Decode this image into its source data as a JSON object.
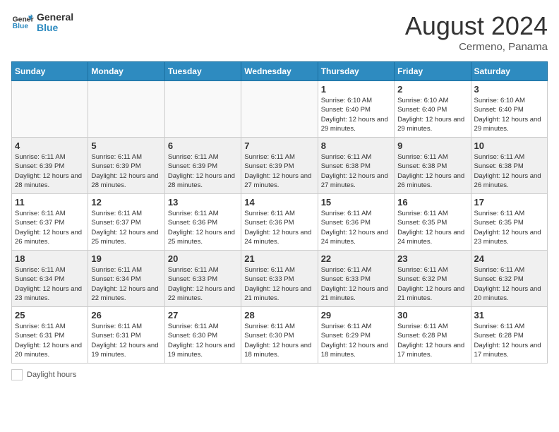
{
  "logo": {
    "text_general": "General",
    "text_blue": "Blue"
  },
  "header": {
    "month": "August 2024",
    "location": "Cermeno, Panama"
  },
  "days_of_week": [
    "Sunday",
    "Monday",
    "Tuesday",
    "Wednesday",
    "Thursday",
    "Friday",
    "Saturday"
  ],
  "weeks": [
    [
      {
        "day": "",
        "info": ""
      },
      {
        "day": "",
        "info": ""
      },
      {
        "day": "",
        "info": ""
      },
      {
        "day": "",
        "info": ""
      },
      {
        "day": "1",
        "info": "Sunrise: 6:10 AM\nSunset: 6:40 PM\nDaylight: 12 hours\nand 29 minutes."
      },
      {
        "day": "2",
        "info": "Sunrise: 6:10 AM\nSunset: 6:40 PM\nDaylight: 12 hours\nand 29 minutes."
      },
      {
        "day": "3",
        "info": "Sunrise: 6:10 AM\nSunset: 6:40 PM\nDaylight: 12 hours\nand 29 minutes."
      }
    ],
    [
      {
        "day": "4",
        "info": "Sunrise: 6:11 AM\nSunset: 6:39 PM\nDaylight: 12 hours\nand 28 minutes."
      },
      {
        "day": "5",
        "info": "Sunrise: 6:11 AM\nSunset: 6:39 PM\nDaylight: 12 hours\nand 28 minutes."
      },
      {
        "day": "6",
        "info": "Sunrise: 6:11 AM\nSunset: 6:39 PM\nDaylight: 12 hours\nand 28 minutes."
      },
      {
        "day": "7",
        "info": "Sunrise: 6:11 AM\nSunset: 6:39 PM\nDaylight: 12 hours\nand 27 minutes."
      },
      {
        "day": "8",
        "info": "Sunrise: 6:11 AM\nSunset: 6:38 PM\nDaylight: 12 hours\nand 27 minutes."
      },
      {
        "day": "9",
        "info": "Sunrise: 6:11 AM\nSunset: 6:38 PM\nDaylight: 12 hours\nand 26 minutes."
      },
      {
        "day": "10",
        "info": "Sunrise: 6:11 AM\nSunset: 6:38 PM\nDaylight: 12 hours\nand 26 minutes."
      }
    ],
    [
      {
        "day": "11",
        "info": "Sunrise: 6:11 AM\nSunset: 6:37 PM\nDaylight: 12 hours\nand 26 minutes."
      },
      {
        "day": "12",
        "info": "Sunrise: 6:11 AM\nSunset: 6:37 PM\nDaylight: 12 hours\nand 25 minutes."
      },
      {
        "day": "13",
        "info": "Sunrise: 6:11 AM\nSunset: 6:36 PM\nDaylight: 12 hours\nand 25 minutes."
      },
      {
        "day": "14",
        "info": "Sunrise: 6:11 AM\nSunset: 6:36 PM\nDaylight: 12 hours\nand 24 minutes."
      },
      {
        "day": "15",
        "info": "Sunrise: 6:11 AM\nSunset: 6:36 PM\nDaylight: 12 hours\nand 24 minutes."
      },
      {
        "day": "16",
        "info": "Sunrise: 6:11 AM\nSunset: 6:35 PM\nDaylight: 12 hours\nand 24 minutes."
      },
      {
        "day": "17",
        "info": "Sunrise: 6:11 AM\nSunset: 6:35 PM\nDaylight: 12 hours\nand 23 minutes."
      }
    ],
    [
      {
        "day": "18",
        "info": "Sunrise: 6:11 AM\nSunset: 6:34 PM\nDaylight: 12 hours\nand 23 minutes."
      },
      {
        "day": "19",
        "info": "Sunrise: 6:11 AM\nSunset: 6:34 PM\nDaylight: 12 hours\nand 22 minutes."
      },
      {
        "day": "20",
        "info": "Sunrise: 6:11 AM\nSunset: 6:33 PM\nDaylight: 12 hours\nand 22 minutes."
      },
      {
        "day": "21",
        "info": "Sunrise: 6:11 AM\nSunset: 6:33 PM\nDaylight: 12 hours\nand 21 minutes."
      },
      {
        "day": "22",
        "info": "Sunrise: 6:11 AM\nSunset: 6:33 PM\nDaylight: 12 hours\nand 21 minutes."
      },
      {
        "day": "23",
        "info": "Sunrise: 6:11 AM\nSunset: 6:32 PM\nDaylight: 12 hours\nand 21 minutes."
      },
      {
        "day": "24",
        "info": "Sunrise: 6:11 AM\nSunset: 6:32 PM\nDaylight: 12 hours\nand 20 minutes."
      }
    ],
    [
      {
        "day": "25",
        "info": "Sunrise: 6:11 AM\nSunset: 6:31 PM\nDaylight: 12 hours\nand 20 minutes."
      },
      {
        "day": "26",
        "info": "Sunrise: 6:11 AM\nSunset: 6:31 PM\nDaylight: 12 hours\nand 19 minutes."
      },
      {
        "day": "27",
        "info": "Sunrise: 6:11 AM\nSunset: 6:30 PM\nDaylight: 12 hours\nand 19 minutes."
      },
      {
        "day": "28",
        "info": "Sunrise: 6:11 AM\nSunset: 6:30 PM\nDaylight: 12 hours\nand 18 minutes."
      },
      {
        "day": "29",
        "info": "Sunrise: 6:11 AM\nSunset: 6:29 PM\nDaylight: 12 hours\nand 18 minutes."
      },
      {
        "day": "30",
        "info": "Sunrise: 6:11 AM\nSunset: 6:28 PM\nDaylight: 12 hours\nand 17 minutes."
      },
      {
        "day": "31",
        "info": "Sunrise: 6:11 AM\nSunset: 6:28 PM\nDaylight: 12 hours\nand 17 minutes."
      }
    ]
  ],
  "footer": {
    "legend_label": "Daylight hours"
  }
}
